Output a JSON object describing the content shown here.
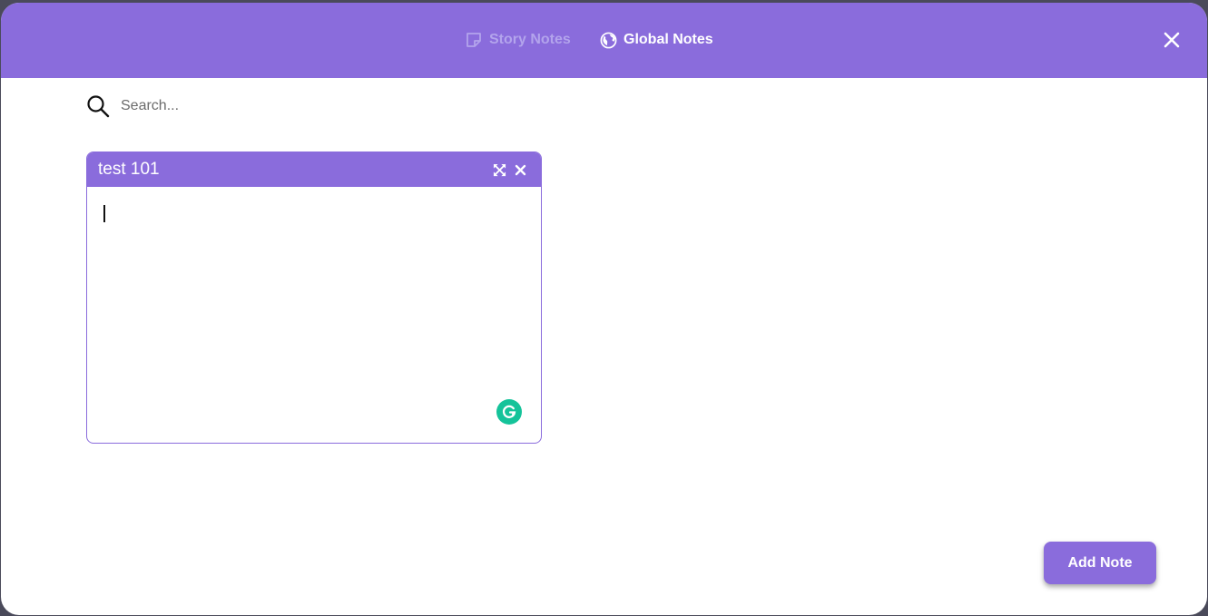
{
  "colors": {
    "accent": "#8a6cdc",
    "tab_inactive": "#b3a4ec",
    "grammarly": "#15c39a"
  },
  "header": {
    "tabs": [
      {
        "label": "Story Notes",
        "icon": "sticky-note-icon",
        "active": false
      },
      {
        "label": "Global Notes",
        "icon": "globe-icon",
        "active": true
      }
    ],
    "close_icon": "close-icon"
  },
  "search": {
    "icon": "search-icon",
    "placeholder": "Search...",
    "value": ""
  },
  "notes": [
    {
      "title": "test 101",
      "content": "",
      "actions": [
        "expand-icon",
        "close-icon"
      ]
    }
  ],
  "footer": {
    "add_note_label": "Add Note"
  }
}
